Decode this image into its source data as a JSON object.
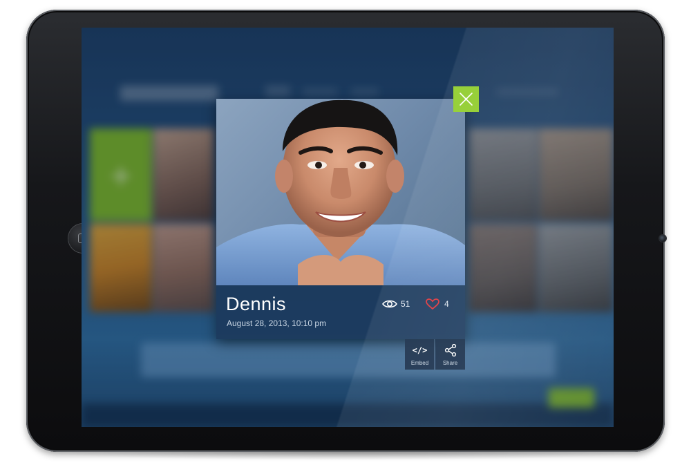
{
  "photo_card": {
    "name": "Dennis",
    "date": "August 28, 2013, 10:10 pm",
    "views": "51",
    "likes": "4"
  },
  "actions": {
    "embed_label": "Embed",
    "embed_glyph": "</>",
    "share_label": "Share"
  },
  "colors": {
    "accent_green": "#8fcc2a",
    "like_red": "#e0353b",
    "info_panel": "#1c3a5c",
    "screen_blue": "#24507d"
  },
  "icons": {
    "close": "close-icon",
    "views": "eye-icon",
    "likes": "heart-icon",
    "embed": "code-icon",
    "share": "share-icon",
    "home": "home-button-icon"
  }
}
